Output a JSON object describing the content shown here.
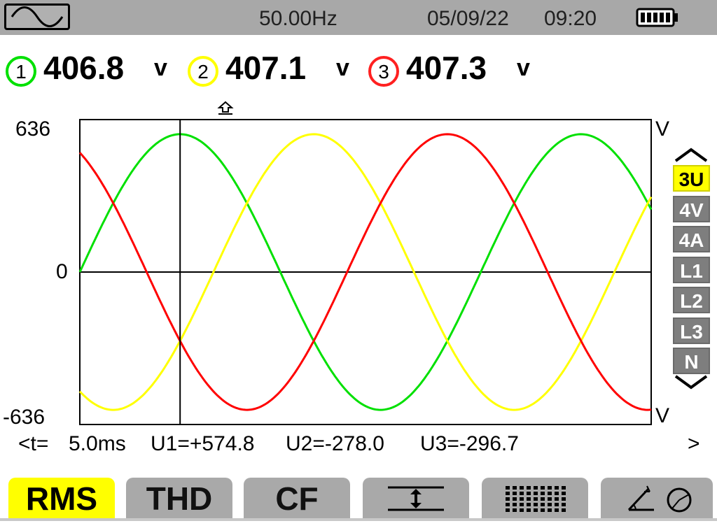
{
  "status_bar": {
    "mode_icon": "sine-wave-icon",
    "frequency": "50.00Hz",
    "date": "05/09/22",
    "time": "09:20",
    "battery_icon": "battery-full-icon"
  },
  "channels": [
    {
      "number": "1",
      "value": "406.8",
      "unit": "v",
      "color": "#00e000"
    },
    {
      "number": "2",
      "value": "407.1",
      "unit": "v",
      "color": "#ffff00"
    },
    {
      "number": "3",
      "value": "407.3",
      "unit": "v",
      "color": "#ff0000"
    }
  ],
  "axis": {
    "y_max_label": "636",
    "y_zero_label": "0",
    "y_min_label": "-636",
    "unit_top": "V",
    "unit_bottom": "V",
    "cursor_marker_icon": "cursor-arrow-icon"
  },
  "waveforms": {
    "amplitude_peak": 575,
    "frequency_hz": 50,
    "time_span_ms": 28.5,
    "cursor_time_ms": 5.0,
    "phases": [
      {
        "name": "U1",
        "color": "#00e000",
        "phase_deg": 0
      },
      {
        "name": "U2",
        "color": "#ffff00",
        "phase_deg": -120
      },
      {
        "name": "U3",
        "color": "#ff0000",
        "phase_deg": 120
      }
    ]
  },
  "side_menu": {
    "up_icon": "chevron-up-icon",
    "down_icon": "chevron-down-icon",
    "items": [
      {
        "label": "3U",
        "active": true
      },
      {
        "label": "4V",
        "active": false
      },
      {
        "label": "4A",
        "active": false
      },
      {
        "label": "L1",
        "active": false
      },
      {
        "label": "L2",
        "active": false
      },
      {
        "label": "L3",
        "active": false
      },
      {
        "label": "N",
        "active": false
      }
    ]
  },
  "readout": {
    "time_prefix": "<t=",
    "time_value": "5.0ms",
    "u1": "U1=+574.8",
    "u2": "U2=-278.0",
    "u3": "U3=-296.7",
    "next_icon": ">"
  },
  "tabs": [
    {
      "label": "RMS",
      "active": true,
      "icon": ""
    },
    {
      "label": "THD",
      "active": false,
      "icon": ""
    },
    {
      "label": "CF",
      "active": false,
      "icon": ""
    },
    {
      "label": "",
      "active": false,
      "icon": "range-adjust-icon"
    },
    {
      "label": "",
      "active": false,
      "icon": "table-view-icon"
    },
    {
      "label": "",
      "active": false,
      "icon": "phasor-diagram-icon"
    }
  ]
}
